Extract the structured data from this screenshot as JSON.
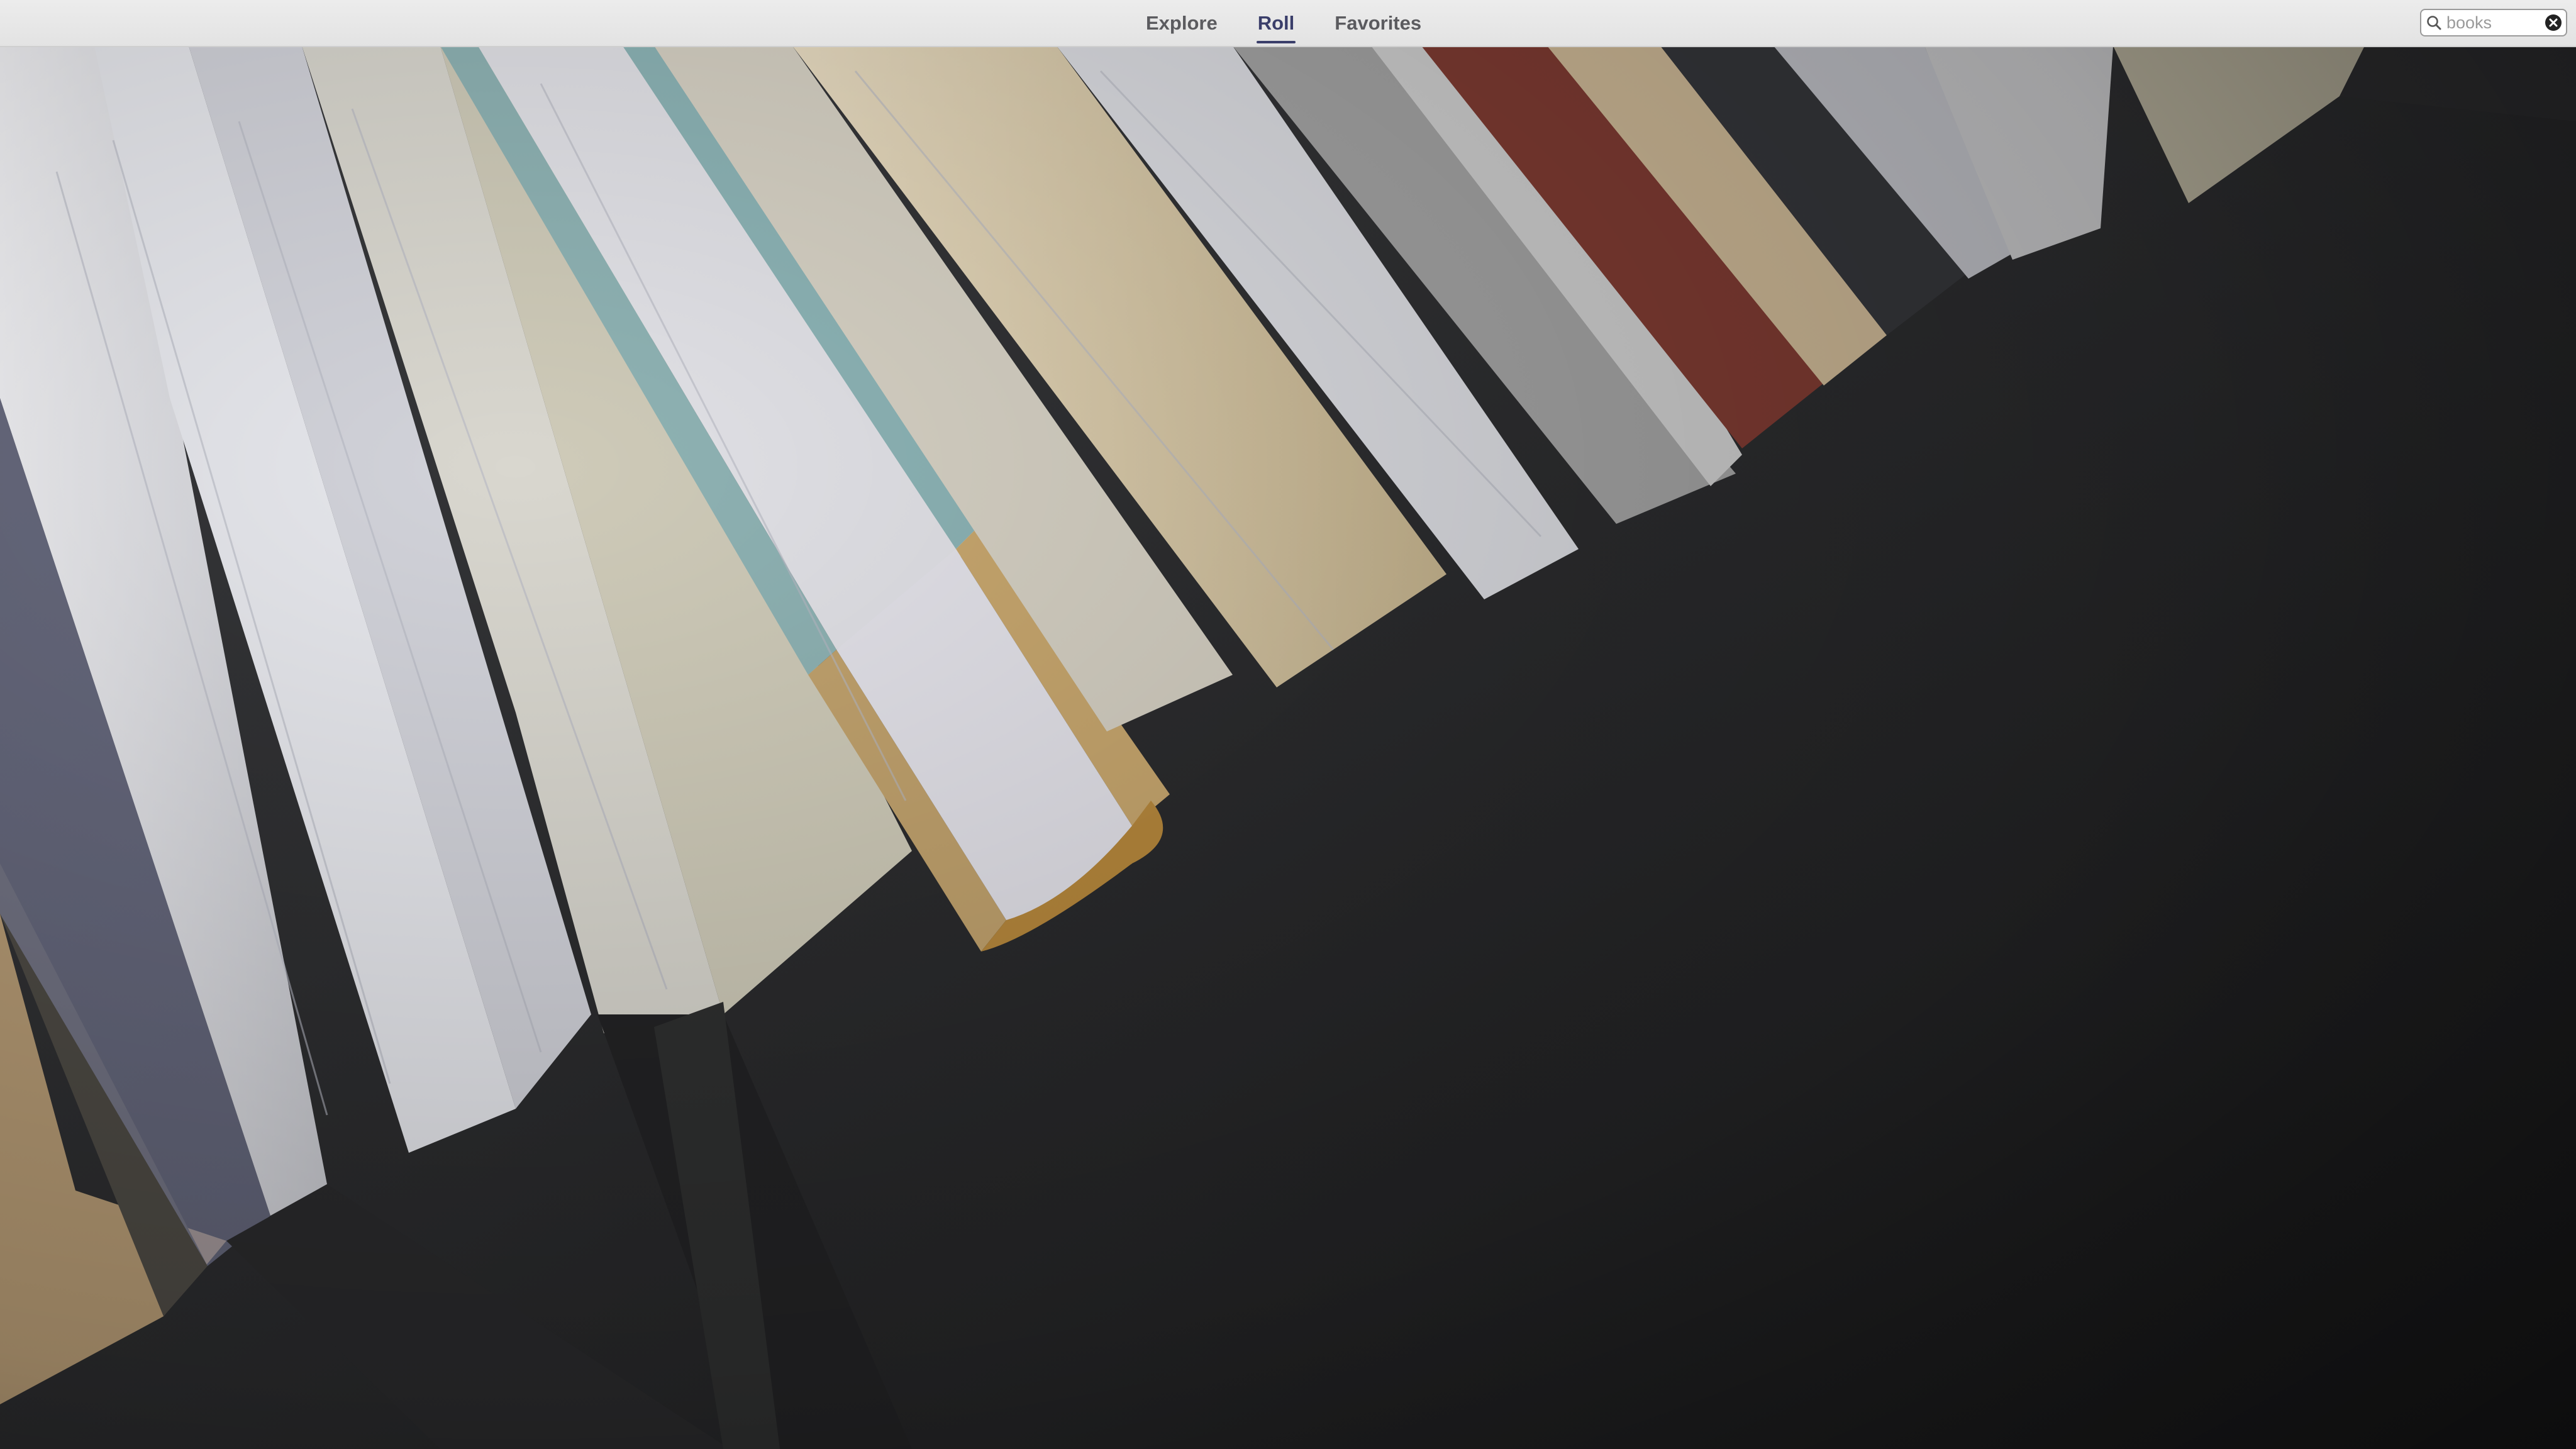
{
  "nav": {
    "tabs": [
      {
        "label": "Explore",
        "active": false
      },
      {
        "label": "Roll",
        "active": true
      },
      {
        "label": "Favorites",
        "active": false
      }
    ]
  },
  "search": {
    "value": "books",
    "icon": "search-icon",
    "clear_icon": "clear-icon"
  },
  "photo": {
    "subject": "books",
    "accent_colors": [
      "#e4e5e8",
      "#8fb3b4",
      "#c2a36e",
      "#d7c3a1",
      "#7e3b32",
      "#2a2a2b"
    ]
  }
}
